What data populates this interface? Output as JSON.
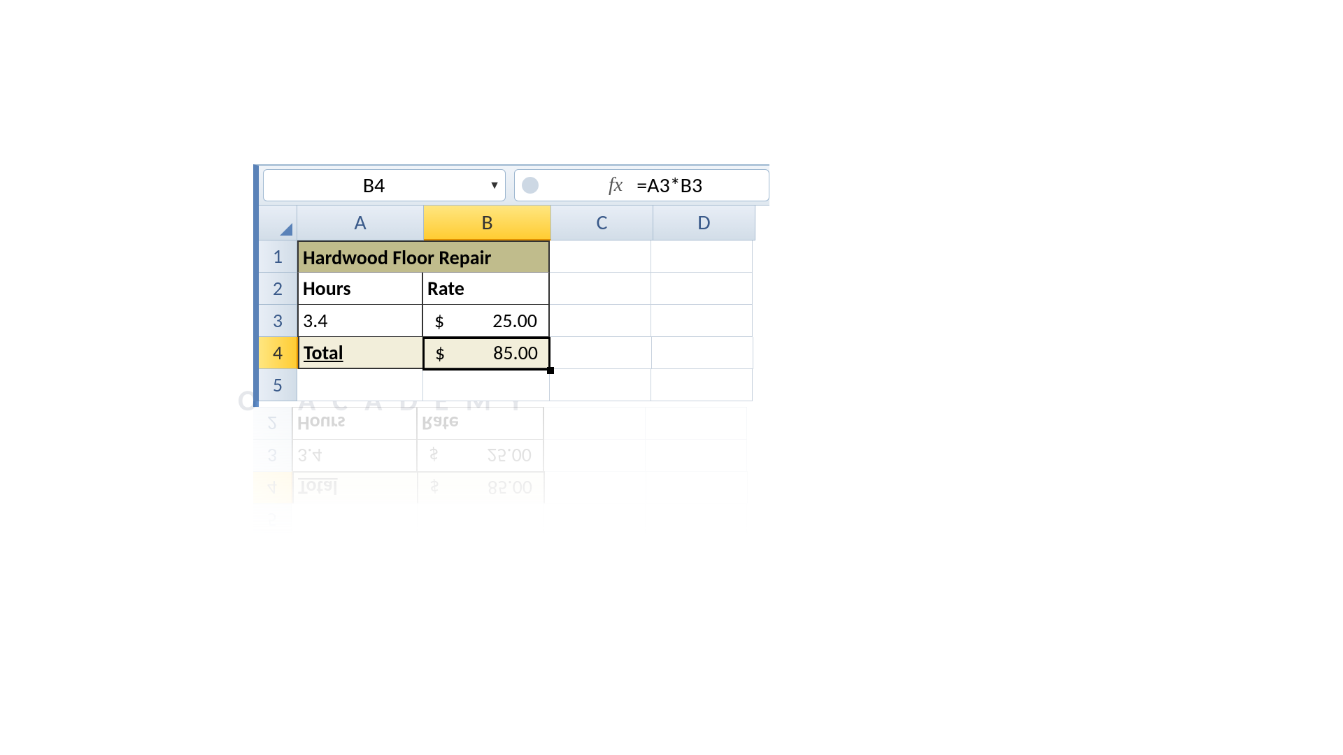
{
  "namebox": {
    "value": "B4"
  },
  "formula_bar": {
    "fx_label": "fx",
    "formula": "=A3*B3"
  },
  "columns": [
    "A",
    "B",
    "C",
    "D"
  ],
  "active_column": "B",
  "active_row": "4",
  "rows": [
    "1",
    "2",
    "3",
    "4",
    "5"
  ],
  "sheet": {
    "title": "Hardwood Floor Repair",
    "headers": {
      "A": "Hours",
      "B": "Rate"
    },
    "data_row": {
      "A": "3.4",
      "B_prefix": "$",
      "B_value": "25.00"
    },
    "total_row": {
      "label": "Total",
      "B_prefix": "$",
      "B_value": "85.00"
    }
  },
  "watermark": "O ACADEMY"
}
